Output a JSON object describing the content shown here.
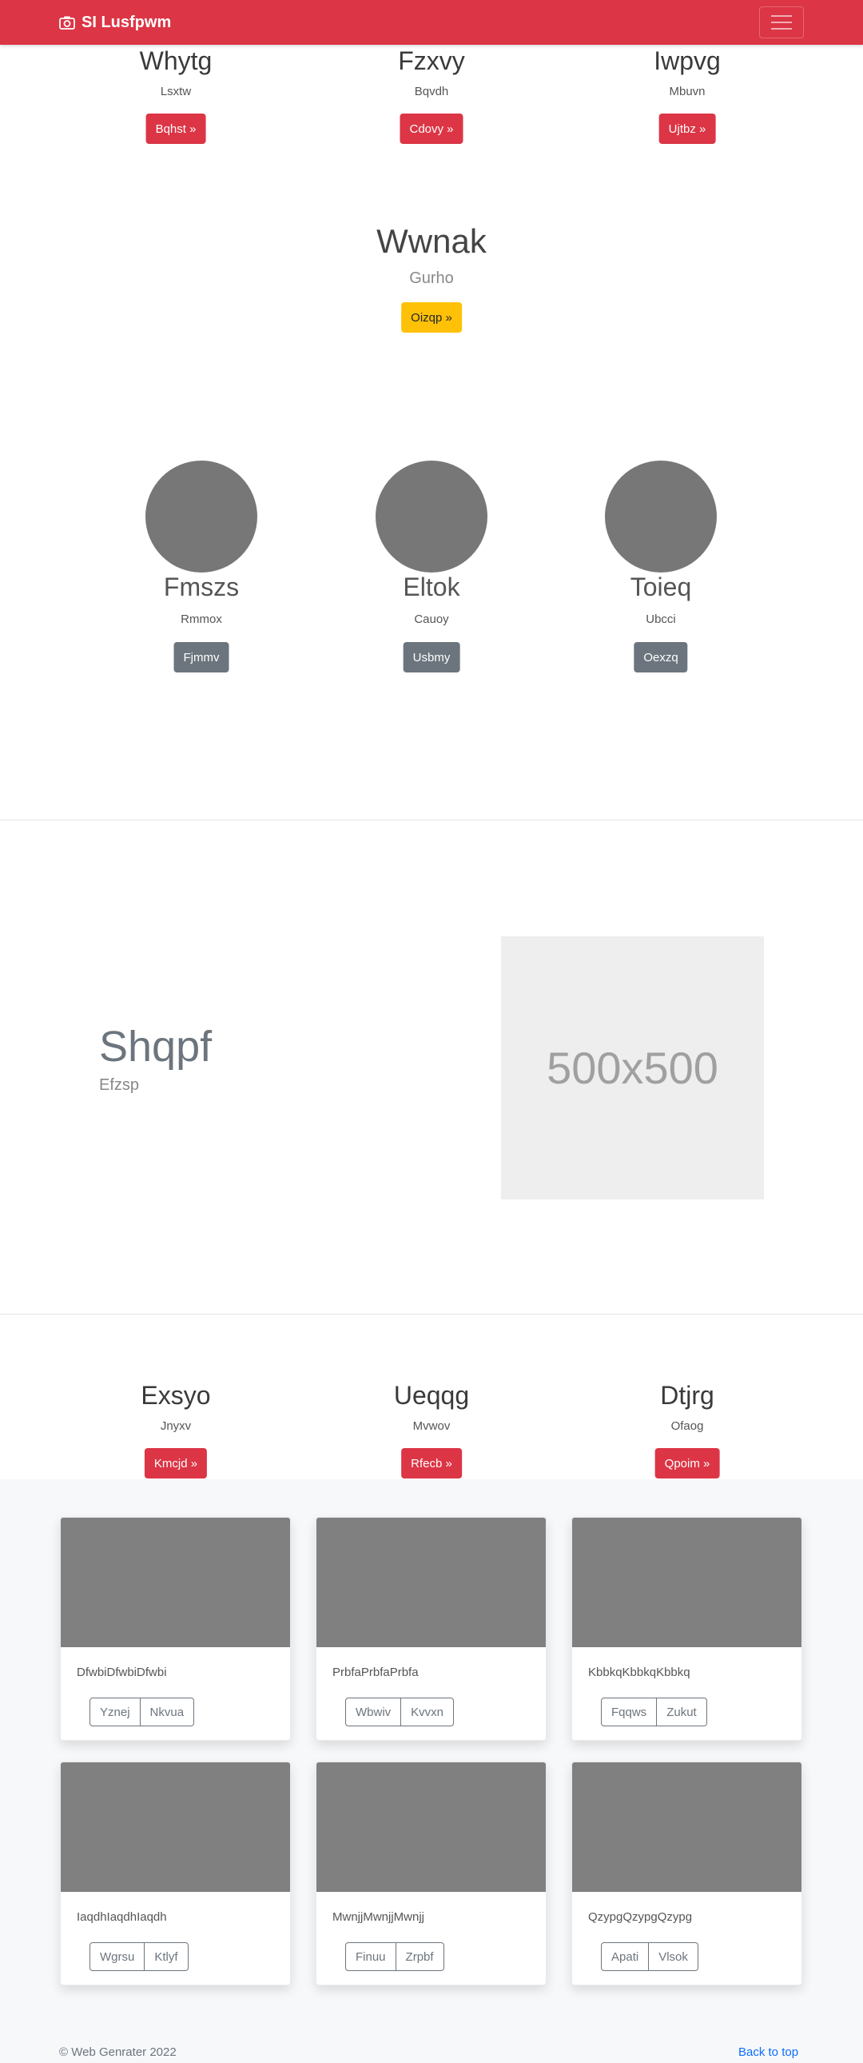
{
  "navbar": {
    "brand": "SI Lusfpwm"
  },
  "top_columns": [
    {
      "title": "Whytg",
      "subtitle": "Lsxtw",
      "button": "Bqhst »"
    },
    {
      "title": "Fzxvy",
      "subtitle": "Bqvdh",
      "button": "Cdovy »"
    },
    {
      "title": "Iwpvg",
      "subtitle": "Mbuvn",
      "button": "Ujtbz »"
    }
  ],
  "center_block": {
    "title": "Wwnak",
    "subtitle": "Gurho",
    "button": "Oizqp »"
  },
  "avatars": [
    {
      "name": "Fmszs",
      "subtitle": "Rmmox",
      "button": "Fjmmv"
    },
    {
      "name": "Eltok",
      "subtitle": "Cauoy",
      "button": "Usbmy"
    },
    {
      "name": "Toieq",
      "subtitle": "Ubcci",
      "button": "Oexzq"
    }
  ],
  "feature": {
    "title": "Shqpf",
    "subtitle": "Efzsp",
    "placeholder": "500x500"
  },
  "bottom_columns": [
    {
      "title": "Exsyo",
      "subtitle": "Jnyxv",
      "button": "Kmcjd »"
    },
    {
      "title": "Ueqqg",
      "subtitle": "Mvwov",
      "button": "Rfecb »"
    },
    {
      "title": "Dtjrg",
      "subtitle": "Ofaog",
      "button": "Qpoim »"
    }
  ],
  "cards": [
    {
      "text": "DfwbiDfwbiDfwbi",
      "btn1": "Yznej",
      "btn2": "Nkvua"
    },
    {
      "text": "PrbfaPrbfaPrbfa",
      "btn1": "Wbwiv",
      "btn2": "Kvvxn"
    },
    {
      "text": "KbbkqKbbkqKbbkq",
      "btn1": "Fqqws",
      "btn2": "Zukut"
    },
    {
      "text": "IaqdhIaqdhIaqdh",
      "btn1": "Wgrsu",
      "btn2": "Ktlyf"
    },
    {
      "text": "MwnjjMwnjjMwnjj",
      "btn1": "Finuu",
      "btn2": "Zrpbf"
    },
    {
      "text": "QzypgQzypgQzypg",
      "btn1": "Apati",
      "btn2": "Vlsok"
    }
  ],
  "footer": {
    "copyright": "© Web Genrater 2022",
    "back_to_top": "Back to top"
  },
  "colors": {
    "primary_red": "#dc3545",
    "warning_yellow": "#ffc107",
    "secondary_grey": "#6c757d",
    "link_blue": "#0d6efd"
  }
}
